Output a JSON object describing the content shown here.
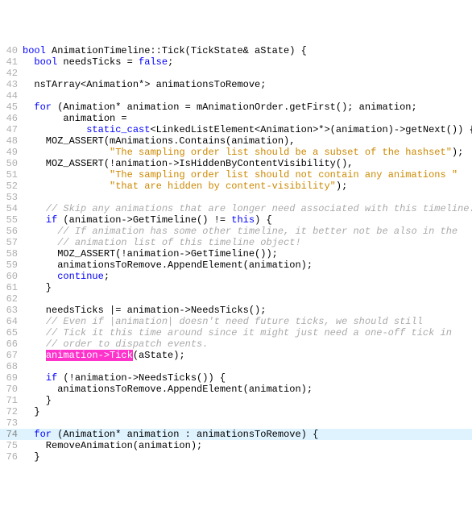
{
  "colors": {
    "keyword": "#0000ff",
    "comment": "#aaaaaa",
    "string": "#cc8800",
    "highlight_bg": "#dff3ff",
    "match_bg": "#ff33cc",
    "gutter": "#b0b0b0"
  },
  "first_line": 40,
  "highlighted_row": 74,
  "search_match": {
    "line": 67,
    "text": "animation->Tick"
  },
  "lines": [
    {
      "n": 40,
      "segs": [
        [
          "kw",
          "bool"
        ],
        [
          "",
          " AnimationTimeline::Tick(TickState& aState) {"
        ]
      ]
    },
    {
      "n": 41,
      "segs": [
        [
          "",
          "  "
        ],
        [
          "kw",
          "bool"
        ],
        [
          "",
          " needsTicks = "
        ],
        [
          "kw",
          "false"
        ],
        [
          "",
          ";"
        ]
      ]
    },
    {
      "n": 42,
      "segs": [
        [
          "",
          ""
        ]
      ]
    },
    {
      "n": 43,
      "segs": [
        [
          "",
          "  nsTArray<Animation*> animationsToRemove;"
        ]
      ]
    },
    {
      "n": 44,
      "segs": [
        [
          "",
          ""
        ]
      ]
    },
    {
      "n": 45,
      "segs": [
        [
          "",
          "  "
        ],
        [
          "kw",
          "for"
        ],
        [
          "",
          " (Animation* animation = mAnimationOrder.getFirst(); animation;"
        ]
      ]
    },
    {
      "n": 46,
      "segs": [
        [
          "",
          "       animation ="
        ]
      ]
    },
    {
      "n": 47,
      "segs": [
        [
          "",
          "           "
        ],
        [
          "kw",
          "static_cast"
        ],
        [
          "",
          "<LinkedListElement<Animation>*>(animation)->getNext()) {"
        ]
      ]
    },
    {
      "n": 48,
      "segs": [
        [
          "",
          "    MOZ_ASSERT(mAnimations.Contains(animation),"
        ]
      ]
    },
    {
      "n": 49,
      "segs": [
        [
          "",
          "               "
        ],
        [
          "str",
          "\"The sampling order list should be a subset of the hashset\""
        ],
        [
          "",
          ");"
        ]
      ]
    },
    {
      "n": 50,
      "segs": [
        [
          "",
          "    MOZ_ASSERT(!animation->IsHiddenByContentVisibility(),"
        ]
      ]
    },
    {
      "n": 51,
      "segs": [
        [
          "",
          "               "
        ],
        [
          "str",
          "\"The sampling order list should not contain any animations \""
        ]
      ]
    },
    {
      "n": 52,
      "segs": [
        [
          "",
          "               "
        ],
        [
          "str",
          "\"that are hidden by content-visibility\""
        ],
        [
          "",
          ");"
        ]
      ]
    },
    {
      "n": 53,
      "segs": [
        [
          "",
          ""
        ]
      ]
    },
    {
      "n": 54,
      "segs": [
        [
          "",
          "    "
        ],
        [
          "comment",
          "// Skip any animations that are longer need associated with this timeline."
        ]
      ]
    },
    {
      "n": 55,
      "segs": [
        [
          "",
          "    "
        ],
        [
          "kw",
          "if"
        ],
        [
          "",
          " (animation->GetTimeline() != "
        ],
        [
          "kw",
          "this"
        ],
        [
          "",
          ") {"
        ]
      ]
    },
    {
      "n": 56,
      "segs": [
        [
          "",
          "      "
        ],
        [
          "comment",
          "// If animation has some other timeline, it better not be also in the"
        ]
      ]
    },
    {
      "n": 57,
      "segs": [
        [
          "",
          "      "
        ],
        [
          "comment",
          "// animation list of this timeline object!"
        ]
      ]
    },
    {
      "n": 58,
      "segs": [
        [
          "",
          "      MOZ_ASSERT(!animation->GetTimeline());"
        ]
      ]
    },
    {
      "n": 59,
      "segs": [
        [
          "",
          "      animationsToRemove.AppendElement(animation);"
        ]
      ]
    },
    {
      "n": 60,
      "segs": [
        [
          "",
          "      "
        ],
        [
          "kw",
          "continue"
        ],
        [
          "",
          ";"
        ]
      ]
    },
    {
      "n": 61,
      "segs": [
        [
          "",
          "    }"
        ]
      ]
    },
    {
      "n": 62,
      "segs": [
        [
          "",
          ""
        ]
      ]
    },
    {
      "n": 63,
      "segs": [
        [
          "",
          "    needsTicks |= animation->NeedsTicks();"
        ]
      ]
    },
    {
      "n": 64,
      "segs": [
        [
          "",
          "    "
        ],
        [
          "comment",
          "// Even if |animation| doesn't need future ticks, we should still"
        ]
      ]
    },
    {
      "n": 65,
      "segs": [
        [
          "",
          "    "
        ],
        [
          "comment",
          "// Tick it this time around since it might just need a one-off tick in"
        ]
      ]
    },
    {
      "n": 66,
      "segs": [
        [
          "",
          "    "
        ],
        [
          "comment",
          "// order to dispatch events."
        ]
      ]
    },
    {
      "n": 67,
      "segs": [
        [
          "",
          "    "
        ],
        [
          "hl-pink",
          "animation->Tick"
        ],
        [
          "",
          "(aState);"
        ]
      ]
    },
    {
      "n": 68,
      "segs": [
        [
          "",
          ""
        ]
      ]
    },
    {
      "n": 69,
      "segs": [
        [
          "",
          "    "
        ],
        [
          "kw",
          "if"
        ],
        [
          "",
          " (!animation->NeedsTicks()) {"
        ]
      ]
    },
    {
      "n": 70,
      "segs": [
        [
          "",
          "      animationsToRemove.AppendElement(animation);"
        ]
      ]
    },
    {
      "n": 71,
      "segs": [
        [
          "",
          "    }"
        ]
      ]
    },
    {
      "n": 72,
      "segs": [
        [
          "",
          "  }"
        ]
      ]
    },
    {
      "n": 73,
      "segs": [
        [
          "",
          ""
        ]
      ]
    },
    {
      "n": 74,
      "segs": [
        [
          "",
          "  "
        ],
        [
          "kw",
          "for"
        ],
        [
          "",
          " (Animation* animation : animationsToRemove) {"
        ]
      ]
    },
    {
      "n": 75,
      "segs": [
        [
          "",
          "    RemoveAnimation(animation);"
        ]
      ]
    },
    {
      "n": 76,
      "segs": [
        [
          "",
          "  }"
        ]
      ]
    }
  ]
}
